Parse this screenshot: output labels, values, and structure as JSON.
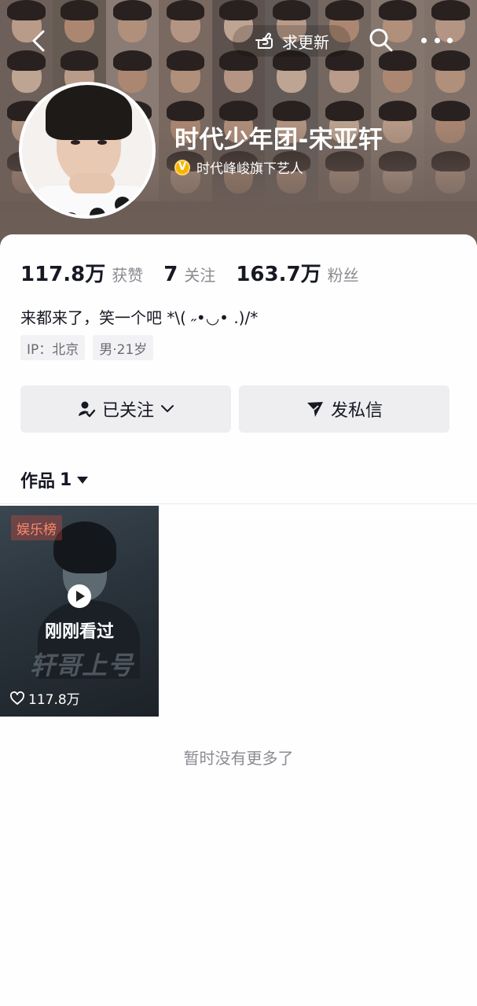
{
  "topbar": {
    "update_label": "求更新"
  },
  "profile": {
    "name": "时代少年团-宋亚轩",
    "verify_text": "时代峰峻旗下艺人",
    "verify_badge": "V"
  },
  "stats": {
    "likes_value": "117.8万",
    "likes_label": "获赞",
    "following_value": "7",
    "following_label": "关注",
    "followers_value": "163.7万",
    "followers_label": "粉丝"
  },
  "bio": "来都来了，笑一个吧 *\\( ˶•◡• .)/*",
  "tags": [
    "IP：北京",
    "男·21岁"
  ],
  "actions": {
    "follow_label": "已关注",
    "message_label": "发私信"
  },
  "works": {
    "label": "作品",
    "count": "1",
    "video": {
      "rank_badge": "娱乐榜",
      "watched_label": "刚刚看过",
      "overlay_title": "轩哥上号",
      "likes": "117.8万"
    }
  },
  "footer": {
    "no_more": "暂时没有更多了"
  },
  "colors": {
    "banner_bg": "#6e5f58",
    "verify_badge": "#f8b400",
    "button_bg": "#eeeef0",
    "muted_text": "#8a8b91"
  }
}
